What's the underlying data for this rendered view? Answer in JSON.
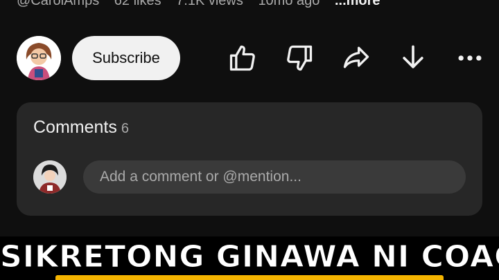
{
  "video_meta": {
    "channel_handle": "@CarolAmps",
    "likes": "62 likes",
    "views": "7.1K views",
    "age": "10mo ago",
    "more_label": "...more"
  },
  "actions": {
    "subscribe_label": "Subscribe",
    "icons": [
      "thumbs-up-icon",
      "thumbs-down-icon",
      "share-icon",
      "download-icon",
      "more-icon"
    ]
  },
  "comments": {
    "title": "Comments",
    "count": "6",
    "input_placeholder": "Add a comment or @mention..."
  },
  "banner": {
    "title": "SIKRETONG GINAWA NI COACH"
  },
  "colors": {
    "background": "#0f0f0f",
    "card": "#272727",
    "input": "#3a3a3a",
    "banner_accent": "#f5b400"
  }
}
